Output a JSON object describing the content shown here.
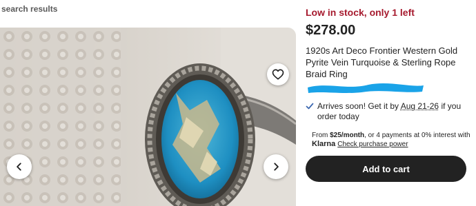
{
  "breadcrumb": "search results",
  "listing": {
    "stock_status": "Low in stock, only 1 left",
    "price": "$278.00",
    "title": "1920s Art Deco Frontier Western Gold Pyrite Vein Turquoise & Sterling Rope Braid Ring"
  },
  "delivery": {
    "prefix": "Arrives soon! Get it by ",
    "date_range": "Aug 21-26",
    "suffix": " if you order today"
  },
  "payment": {
    "from_text": "From ",
    "monthly": "$25/month",
    "rest_text": ", or 4 payments at 0% interest with",
    "provider": "Klarna",
    "link": "Check purchase power"
  },
  "actions": {
    "add_to_cart": "Add to cart"
  },
  "icons": {
    "favorite": "heart-icon",
    "prev": "chevron-left-icon",
    "next": "chevron-right-icon",
    "check": "check-icon"
  },
  "colors": {
    "stock_red": "#a61a2e",
    "redaction_blue": "#1aa3e8",
    "button_dark": "#222222",
    "check_blue": "#3b67b0"
  }
}
